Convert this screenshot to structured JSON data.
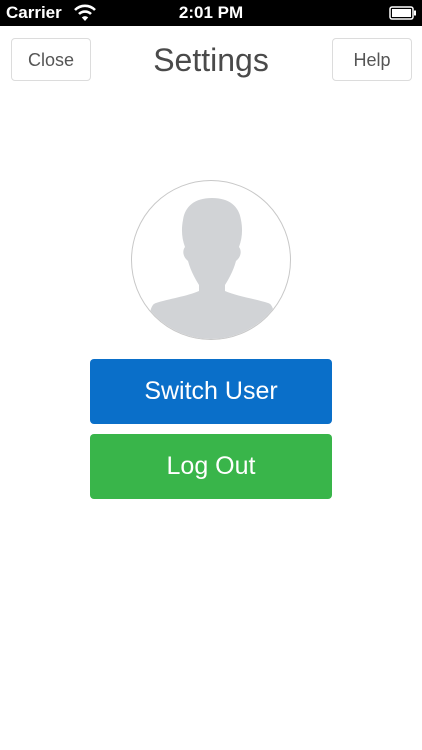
{
  "status_bar": {
    "carrier": "Carrier",
    "time": "2:01 PM",
    "icons": [
      "wifi-icon",
      "battery-icon"
    ]
  },
  "header": {
    "title": "Settings",
    "close_label": "Close",
    "help_label": "Help"
  },
  "profile": {
    "avatar_icon": "person-silhouette-icon"
  },
  "actions": {
    "switch_user_label": "Switch User",
    "logout_label": "Log Out"
  },
  "colors": {
    "switch_user": "#0a6fc9",
    "logout": "#39b54a",
    "status_bar": "#000000"
  }
}
